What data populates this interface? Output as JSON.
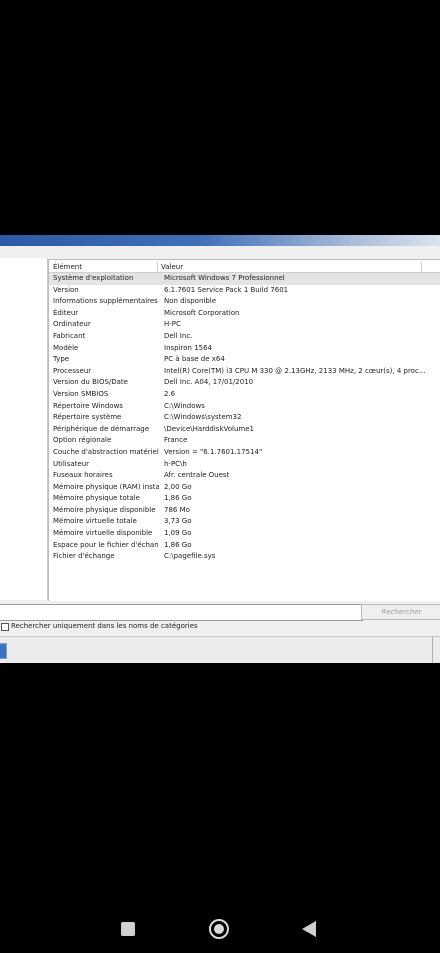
{
  "list": {
    "columns": [
      "Élément",
      "Valeur"
    ],
    "rows": [
      {
        "key": "Système d'exploitation",
        "value": "Microsoft Windows 7 Professionnel"
      },
      {
        "key": "Version",
        "value": "6.1.7601 Service Pack 1 Build 7601"
      },
      {
        "key": "Informations supplémentaires",
        "value": "Non disponible"
      },
      {
        "key": "Éditeur",
        "value": "Microsoft Corporation"
      },
      {
        "key": "Ordinateur",
        "value": "H-PC"
      },
      {
        "key": "Fabricant",
        "value": "Dell Inc."
      },
      {
        "key": "Modèle",
        "value": "Inspiron 1564"
      },
      {
        "key": "Type",
        "value": "PC à base de x64"
      },
      {
        "key": "Processeur",
        "value": "Intel(R) Core(TM) i3 CPU       M 330  @ 2.13GHz, 2133 MHz, 2 cœur(s), 4 proc..."
      },
      {
        "key": "Version du BIOS/Date",
        "value": "Dell Inc. A04, 17/01/2010"
      },
      {
        "key": "Version SMBIOS",
        "value": "2.6"
      },
      {
        "key": "Répertoire Windows",
        "value": "C:\\Windows"
      },
      {
        "key": "Répertoire système",
        "value": "C:\\Windows\\system32"
      },
      {
        "key": "Périphérique de démarrage",
        "value": "\\Device\\HarddiskVolume1"
      },
      {
        "key": "Option régionale",
        "value": "France"
      },
      {
        "key": "Couche d'abstraction matérielle",
        "value": "Version = \"6.1.7601.17514\""
      },
      {
        "key": "Utilisateur",
        "value": "h-PC\\h"
      },
      {
        "key": "Fuseaux horaires",
        "value": "Afr. centrale Ouest"
      },
      {
        "key": "Mémoire physique (RAM) instal...",
        "value": "2,00 Go"
      },
      {
        "key": "Mémoire physique totale",
        "value": "1,86 Go"
      },
      {
        "key": "Mémoire physique disponible",
        "value": "786 Mo"
      },
      {
        "key": "Mémoire virtuelle totale",
        "value": "3,73 Go"
      },
      {
        "key": "Mémoire virtuelle disponible",
        "value": "1,09 Go"
      },
      {
        "key": "Espace pour le fichier d'échange",
        "value": "1,86 Go"
      },
      {
        "key": "Fichier d'échange",
        "value": "C:\\pagefile.sys"
      }
    ]
  },
  "search": {
    "input_value": "",
    "button_label": "Rechercher",
    "checkbox_label": "Rechercher uniquement dans les noms de catégories",
    "checkbox_checked": false
  },
  "colors": {
    "title_bar": "#2d5aa6",
    "selected_row": "#e3e3e3"
  },
  "android_nav": {
    "icons": [
      "recents-icon",
      "home-icon",
      "back-icon"
    ]
  }
}
